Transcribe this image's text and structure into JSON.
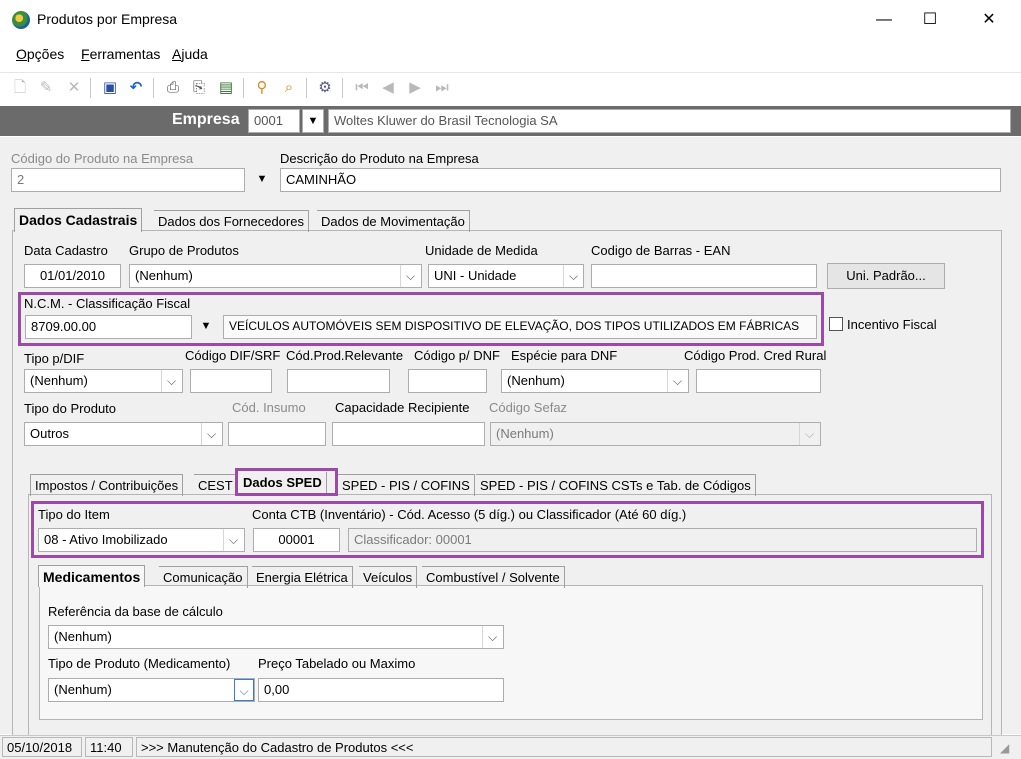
{
  "window": {
    "title": "Produtos por Empresa",
    "minimize": "—",
    "maximize": "☐",
    "close": "✕"
  },
  "menu": {
    "items": [
      {
        "first": "O",
        "rest": "pções"
      },
      {
        "first": "F",
        "rest": "erramentas"
      },
      {
        "first": "A",
        "rest": "juda"
      }
    ]
  },
  "toolbar": {
    "icons": [
      "new-icon",
      "edit-icon",
      "delete-icon",
      "save-icon",
      "undo-icon",
      "print-icon",
      "print-preview-icon",
      "export-icon",
      "lock-icon",
      "search-icon",
      "settings-icon",
      "first-icon",
      "previous-icon",
      "next-icon",
      "last-icon"
    ]
  },
  "empresa": {
    "label": "Empresa",
    "code": "0001",
    "name": "Woltes Kluwer do Brasil Tecnologia SA"
  },
  "produto": {
    "codigo_label": "Código do Produto na Empresa",
    "codigo_value": "2",
    "descricao_label": "Descrição do Produto na Empresa",
    "descricao_value": "CAMINHÃO"
  },
  "main_tabs": [
    "Dados Cadastrais",
    "Dados dos Fornecedores",
    "Dados de Movimentação"
  ],
  "cadastro": {
    "data_label": "Data Cadastro",
    "data_value": "01/01/2010",
    "grupo_label": "Grupo de Produtos",
    "grupo_value": "(Nenhum)",
    "unidade_label": "Unidade de Medida",
    "unidade_value": "UNI - Unidade",
    "barras_label": "Codigo de Barras - EAN",
    "barras_value": "",
    "uni_padrao_btn": "Uni. Padrão...",
    "ncm_label": "N.C.M. -  Classificação Fiscal",
    "ncm_value": "8709.00.00",
    "ncm_desc": "VEÍCULOS AUTOMÓVEIS SEM DISPOSITIVO DE ELEVAÇÃO, DOS TIPOS UTILIZADOS EM FÁBRICAS",
    "incentivo_label": "Incentivo Fiscal",
    "tipo_dif_label": "Tipo p/DIF",
    "tipo_dif_value": "(Nenhum)",
    "cod_dif_label": "Código DIF/SRF",
    "cod_relevante_label": "Cód.Prod.Relevante",
    "cod_dnf_label": "Código p/ DNF",
    "especie_label": "Espécie para DNF",
    "especie_value": "(Nenhum)",
    "cred_rural_label": "Código Prod. Cred Rural",
    "tipo_produto_label": "Tipo do Produto",
    "tipo_produto_value": "Outros",
    "cod_insumo_label": "Cód. Insumo",
    "capacidade_label": "Capacidade Recipiente",
    "sefaz_label": "Código Sefaz",
    "sefaz_value": "(Nenhum)"
  },
  "sub_tabs": [
    "Impostos / Contribuições",
    "CEST",
    "Dados SPED",
    "SPED - PIS / COFINS",
    "SPED - PIS / COFINS CSTs e Tab. de Códigos"
  ],
  "sped": {
    "tipo_item_label": "Tipo do Item",
    "tipo_item_value": "08 - Ativo Imobilizado",
    "conta_label": "Conta CTB (Inventário) - Cód. Acesso (5 díg.) ou Classificador (Até 60 díg.)",
    "conta_value": "00001",
    "classificador_value": "Classificador: 00001"
  },
  "inner_tabs": [
    "Medicamentos",
    "Comunicação",
    "Energia Elétrica",
    "Veículos",
    "Combustível / Solvente"
  ],
  "medicamentos": {
    "ref_label": "Referência da base de cálculo",
    "ref_value": "(Nenhum)",
    "tipo_label": "Tipo de Produto (Medicamento)",
    "tipo_value": "(Nenhum)",
    "preco_label": "Preço Tabelado ou Maximo",
    "preco_value": "0,00"
  },
  "status": {
    "date": "05/10/2018",
    "time": "11:40",
    "message": ">>> Manutenção do Cadastro de Produtos <<<"
  }
}
